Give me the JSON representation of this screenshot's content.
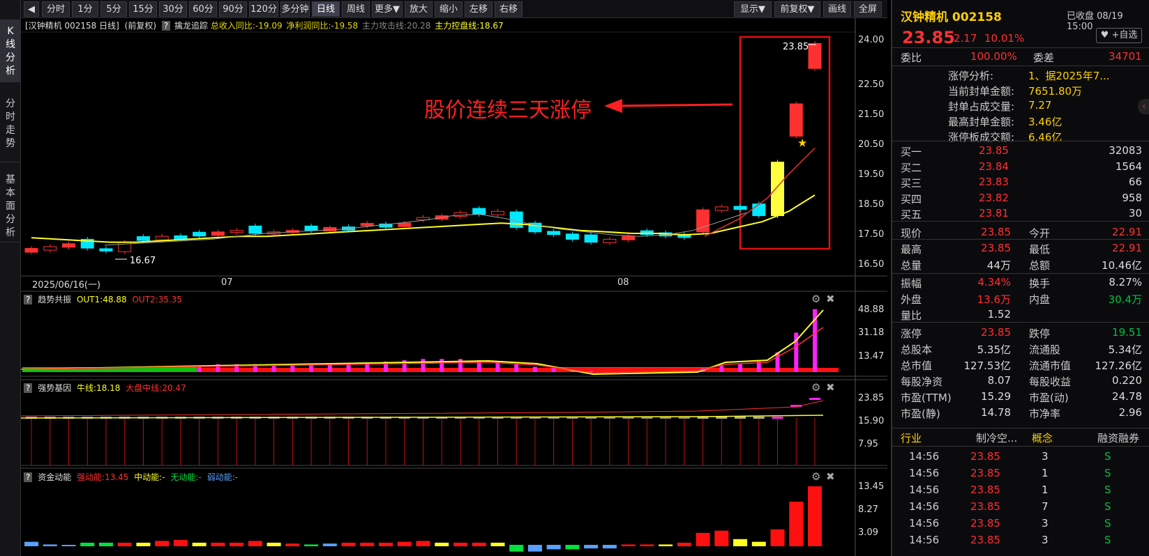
{
  "leftbar": {
    "tabs": [
      "K线分析",
      "分时走势",
      "基本面分析"
    ]
  },
  "toolbar": {
    "buttons": [
      "分时",
      "1分",
      "5分",
      "15分",
      "30分",
      "60分",
      "90分",
      "120分",
      "多分钟",
      "日线",
      "周线",
      "更多▼",
      "放大",
      "缩小",
      "左移",
      "右移"
    ],
    "active": "日线",
    "right_buttons": [
      "显示▼",
      "前复权▼",
      "画线",
      "全屏"
    ]
  },
  "info": {
    "stock": "[汉钟精机 002158 日线]",
    "adj": "(前复权)",
    "indicator": "擒龙追踪",
    "rev": "总收入同比:-19.09",
    "profit": "净利润同比:-19.58",
    "attack": "主力攻击线:20.28",
    "control": "主力控盘线:18.67"
  },
  "main_chart": {
    "y_ticks": [
      "24.00",
      "22.50",
      "21.50",
      "20.50",
      "19.50",
      "18.50",
      "17.50",
      "16.50"
    ],
    "x_labels": [
      "2025/06/16(一)",
      "07",
      "08"
    ],
    "annotation": "股价连续三天涨停",
    "high_label": "23.85",
    "low_label": "16.67"
  },
  "sub1": {
    "name": "趋势共振",
    "out1": "OUT1:48.88",
    "out2": "OUT2:35.35",
    "ticks": [
      "48.88",
      "31.18",
      "13.47"
    ]
  },
  "sub2": {
    "name": "强势基因",
    "l1": "牛线:18.18",
    "l2": "大盘中线:20.47",
    "ticks": [
      "23.85",
      "15.90",
      "7.95"
    ]
  },
  "sub3": {
    "name": "资金动能",
    "l1": "强动能:13.45",
    "l2": "中动能:-",
    "l3": "无动能:-",
    "l4": "弱动能:-",
    "ticks": [
      "13.45",
      "8.27",
      "3.09"
    ]
  },
  "right": {
    "name": "汉钟精机 002158",
    "status": "已收盘 08/19 15:00",
    "price": "23.85",
    "chg": "2.17",
    "pct": "10.01%",
    "watch": "+自选",
    "wb": {
      "l1": "委比",
      "v1": "100.00%",
      "l2": "委差",
      "v2": "34701"
    },
    "zt": [
      {
        "l": "涨停分析:",
        "v": "1、据2025年7..."
      },
      {
        "l": "当前封单金额:",
        "v": "7651.80万"
      },
      {
        "l": "封单占成交量:",
        "v": "7.27"
      },
      {
        "l": "最高封单金额:",
        "v": "3.46亿"
      },
      {
        "l": "涨停板成交额:",
        "v": "6.46亿"
      }
    ],
    "bids": [
      {
        "l": "买一",
        "p": "23.85",
        "v": "32083"
      },
      {
        "l": "买二",
        "p": "23.84",
        "v": "1564"
      },
      {
        "l": "买三",
        "p": "23.83",
        "v": "66"
      },
      {
        "l": "买四",
        "p": "23.82",
        "v": "958"
      },
      {
        "l": "买五",
        "p": "23.81",
        "v": "30"
      }
    ],
    "quote": [
      [
        "现价",
        "23.85",
        "今开",
        "22.91"
      ],
      [
        "最高",
        "23.85",
        "最低",
        "22.91"
      ],
      [
        "总量",
        "44万",
        "总额",
        "10.46亿"
      ],
      [
        "振幅",
        "4.34%",
        "换手",
        "8.27%"
      ],
      [
        "外盘",
        "13.6万",
        "内盘",
        "30.4万"
      ],
      [
        "量比",
        "1.52",
        "",
        ""
      ],
      [
        "涨停",
        "23.85",
        "跌停",
        "19.51"
      ],
      [
        "总股本",
        "5.35亿",
        "流通股",
        "5.34亿"
      ],
      [
        "总市值",
        "127.53亿",
        "流通市值",
        "127.26亿"
      ],
      [
        "每股净资",
        "8.07",
        "每股收益",
        "0.220"
      ],
      [
        "市盈(TTM)",
        "15.29",
        "市盈(动)",
        "24.78"
      ],
      [
        "市盈(静)",
        "14.78",
        "市净率",
        "2.96"
      ]
    ],
    "tabs": [
      "行业",
      "制冷空...",
      "概念",
      "融资融券"
    ],
    "ticks": [
      [
        "14:56",
        "23.85",
        "3",
        "S"
      ],
      [
        "14:56",
        "23.85",
        "1",
        "S"
      ],
      [
        "14:56",
        "23.85",
        "1",
        "S"
      ],
      [
        "14:56",
        "23.85",
        "7",
        "S"
      ],
      [
        "14:56",
        "23.85",
        "3",
        "S"
      ],
      [
        "14:56",
        "23.85",
        "3",
        "S"
      ]
    ]
  },
  "colors": {
    "up": "#ff3030",
    "down": "#00e8ff",
    "ma_yellow": "#ffff20",
    "ma_gray": "#999999",
    "ma_red": "#e03030",
    "annot": "#ff2020",
    "yellow_text": "#e8d800",
    "green": "#00c040"
  },
  "chart_data": {
    "type": "candlestick",
    "x_labels": [
      "2025/06/16(一)",
      "07",
      "08"
    ],
    "ylim": [
      16.5,
      24.0
    ],
    "last_three_close": [
      19.82,
      21.8,
      23.85
    ],
    "high": 23.85,
    "low": 16.67
  }
}
